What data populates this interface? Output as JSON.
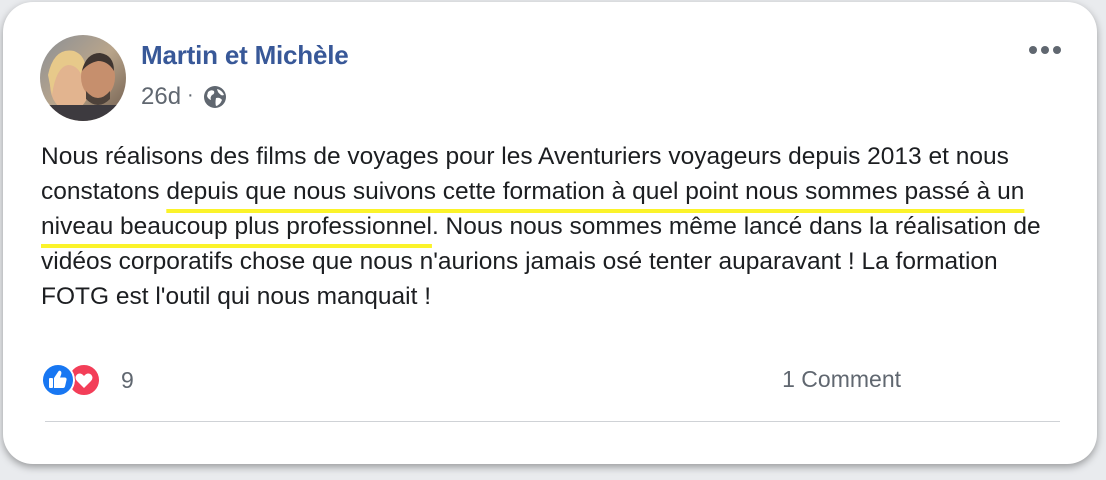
{
  "post": {
    "author": "Martin et Michèle",
    "time": "26d",
    "separator": "·",
    "privacy_icon": "globe-icon",
    "more_icon": "more-options-icon",
    "text_parts": {
      "part1": "Nous réalisons des films de voyages pour les Aventuriers voyageurs depuis 2013 et nous constatons ",
      "highlight": "depuis que nous suivons cette formation à quel point nous sommes passé à un niveau beaucoup plus professionnel",
      "part2": ". Nous nous sommes même lancé dans la réalisation de vidéos corporatifs chose que nous n'aurions jamais osé tenter auparavant ! La formation FOTG est l'outil qui nous manquait !"
    },
    "highlight_color": "#fbf32a"
  },
  "reactions": {
    "icons": [
      "like-icon",
      "love-icon"
    ],
    "count": "9",
    "comments_label": "1 Comment"
  },
  "colors": {
    "author": "#385898",
    "meta": "#606770",
    "like": "#1877f2",
    "love": "#f33e58",
    "text": "#1c1e21"
  }
}
